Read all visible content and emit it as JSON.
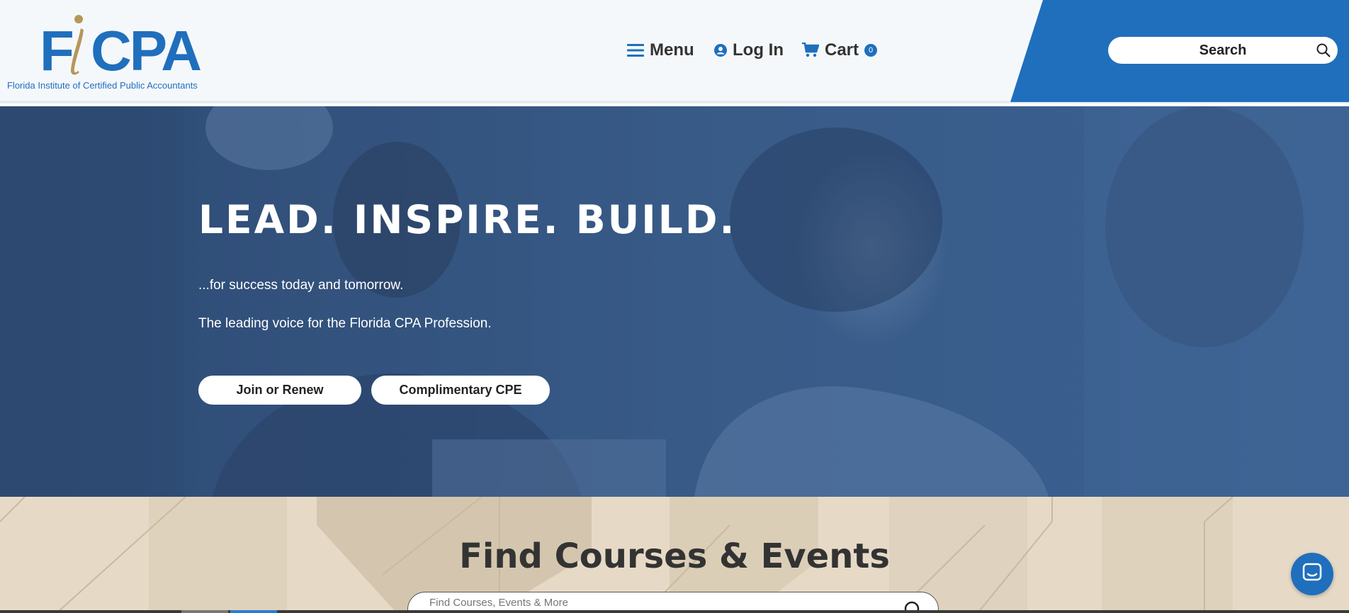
{
  "brand": {
    "logo_text": "FiCPA",
    "org_name": "Florida Institute of Certified Public Accountants",
    "primary_color": "#1f6fbd",
    "accent_color": "#b8965a"
  },
  "nav": {
    "menu_label": "Menu",
    "login_label": "Log In",
    "cart_label": "Cart",
    "cart_count": "0",
    "search_label": "Search"
  },
  "hero": {
    "title": "LEAD. INSPIRE. BUILD.",
    "subtitle": "...for success today and tomorrow.",
    "tagline": "The leading voice for the Florida CPA Profession.",
    "buttons": [
      {
        "label": "Join or Renew"
      },
      {
        "label": "Complimentary CPE"
      }
    ]
  },
  "courses": {
    "title": "Find Courses & Events",
    "search_placeholder": "Find Courses, Events & More"
  },
  "icons": {
    "menu": "hamburger-icon",
    "login": "user-circle-icon",
    "cart": "shopping-cart-icon",
    "search": "search-icon",
    "chat": "chat-icon"
  }
}
